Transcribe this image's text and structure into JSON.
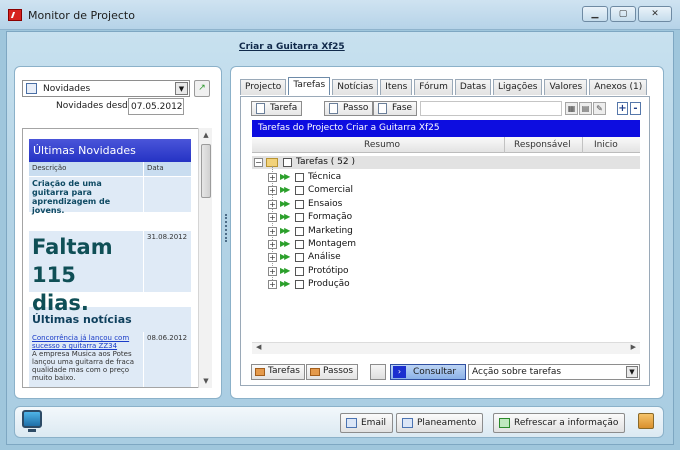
{
  "window": {
    "title": "Monitor de Projecto"
  },
  "project_link": "Criar a Guitarra Xf25",
  "left": {
    "news_select": "Novidades",
    "since_label": "Novidades desde",
    "since_value": "07.05.2012",
    "latest_header": "Últimas Novidades",
    "col_description": "Descrição",
    "col_date": "Data",
    "first_item": "Criação de uma guitarra para aprendizagem de jovens.",
    "countdown": "Faltam 115 dias.",
    "countdown_date": "31.08.2012",
    "news_header": "Últimas notícias",
    "news_link": "Concorrência já lançou com sucesso a guitarra ZZ34",
    "news_body": "A empresa Musica aos Potes lançou uma guitarra de fraca qualidade mas com o preço muito baixo.",
    "news_date": "08.06.2012"
  },
  "tabs": [
    {
      "label": "Projecto"
    },
    {
      "label": "Tarefas",
      "active": true
    },
    {
      "label": "Notícias"
    },
    {
      "label": "Itens"
    },
    {
      "label": "Fórum"
    },
    {
      "label": "Datas"
    },
    {
      "label": "Ligações"
    },
    {
      "label": "Valores"
    },
    {
      "label": "Anexos (1)"
    }
  ],
  "toolbar": {
    "tarefa": "Tarefa",
    "passo": "Passo",
    "fase": "Fase"
  },
  "grid": {
    "title": "Tarefas do Projecto Criar a Guitarra Xf25",
    "columns": {
      "summary": "Resumo",
      "responsible": "Responsável",
      "start": "Inicio"
    },
    "root": "Tarefas ( 52 )",
    "items": [
      "Técnica",
      "Comercial",
      "Ensaios",
      "Formação",
      "Marketing",
      "Montagem",
      "Análise",
      "Protótipo",
      "Produção"
    ]
  },
  "bottom_controls": {
    "tarefas_btn": "Tarefas",
    "passos_btn": "Passos",
    "consultar_btn": "Consultar",
    "action_select": "Acção sobre tarefas"
  },
  "footer": {
    "email": "Email",
    "planeamento": "Planeamento",
    "refresh": "Refrescar a informação"
  }
}
